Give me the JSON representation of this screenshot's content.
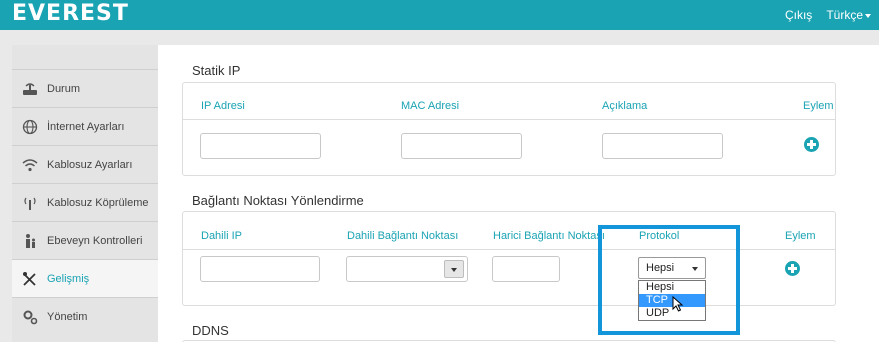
{
  "brand": {
    "logo_text": "EVEREST"
  },
  "topnav": {
    "logout": "Çıkış",
    "language": "Türkçe"
  },
  "sidebar": {
    "items": [
      {
        "label": "Durum",
        "icon": "router-icon"
      },
      {
        "label": "İnternet Ayarları",
        "icon": "globe-icon"
      },
      {
        "label": "Kablosuz Ayarları",
        "icon": "wifi-icon"
      },
      {
        "label": "Kablosuz Köprüleme",
        "icon": "antenna-icon"
      },
      {
        "label": "Ebeveyn Kontrolleri",
        "icon": "family-icon"
      },
      {
        "label": "Gelişmiş",
        "icon": "tools-icon",
        "active": true
      },
      {
        "label": "Yönetim",
        "icon": "gears-icon"
      }
    ]
  },
  "static_ip": {
    "title": "Statik IP",
    "columns": [
      "IP Adresi",
      "MAC Adresi",
      "Açıklama",
      "Eylem"
    ]
  },
  "port_forwarding": {
    "title": "Bağlantı Noktası Yönlendirme",
    "columns": [
      "Dahili IP",
      "Dahili Bağlantı Noktası",
      "Harici Bağlantı Noktası",
      "Protokol",
      "Eylem"
    ],
    "protocol": {
      "selected": "Hepsi",
      "options": [
        "Hepsi",
        "TCP",
        "UDP"
      ],
      "highlighted": "TCP"
    }
  },
  "ddns": {
    "title": "DDNS"
  },
  "colors": {
    "accent": "#1aa3b3",
    "highlight_box": "#1296d9",
    "option_selected": "#3399ff"
  }
}
